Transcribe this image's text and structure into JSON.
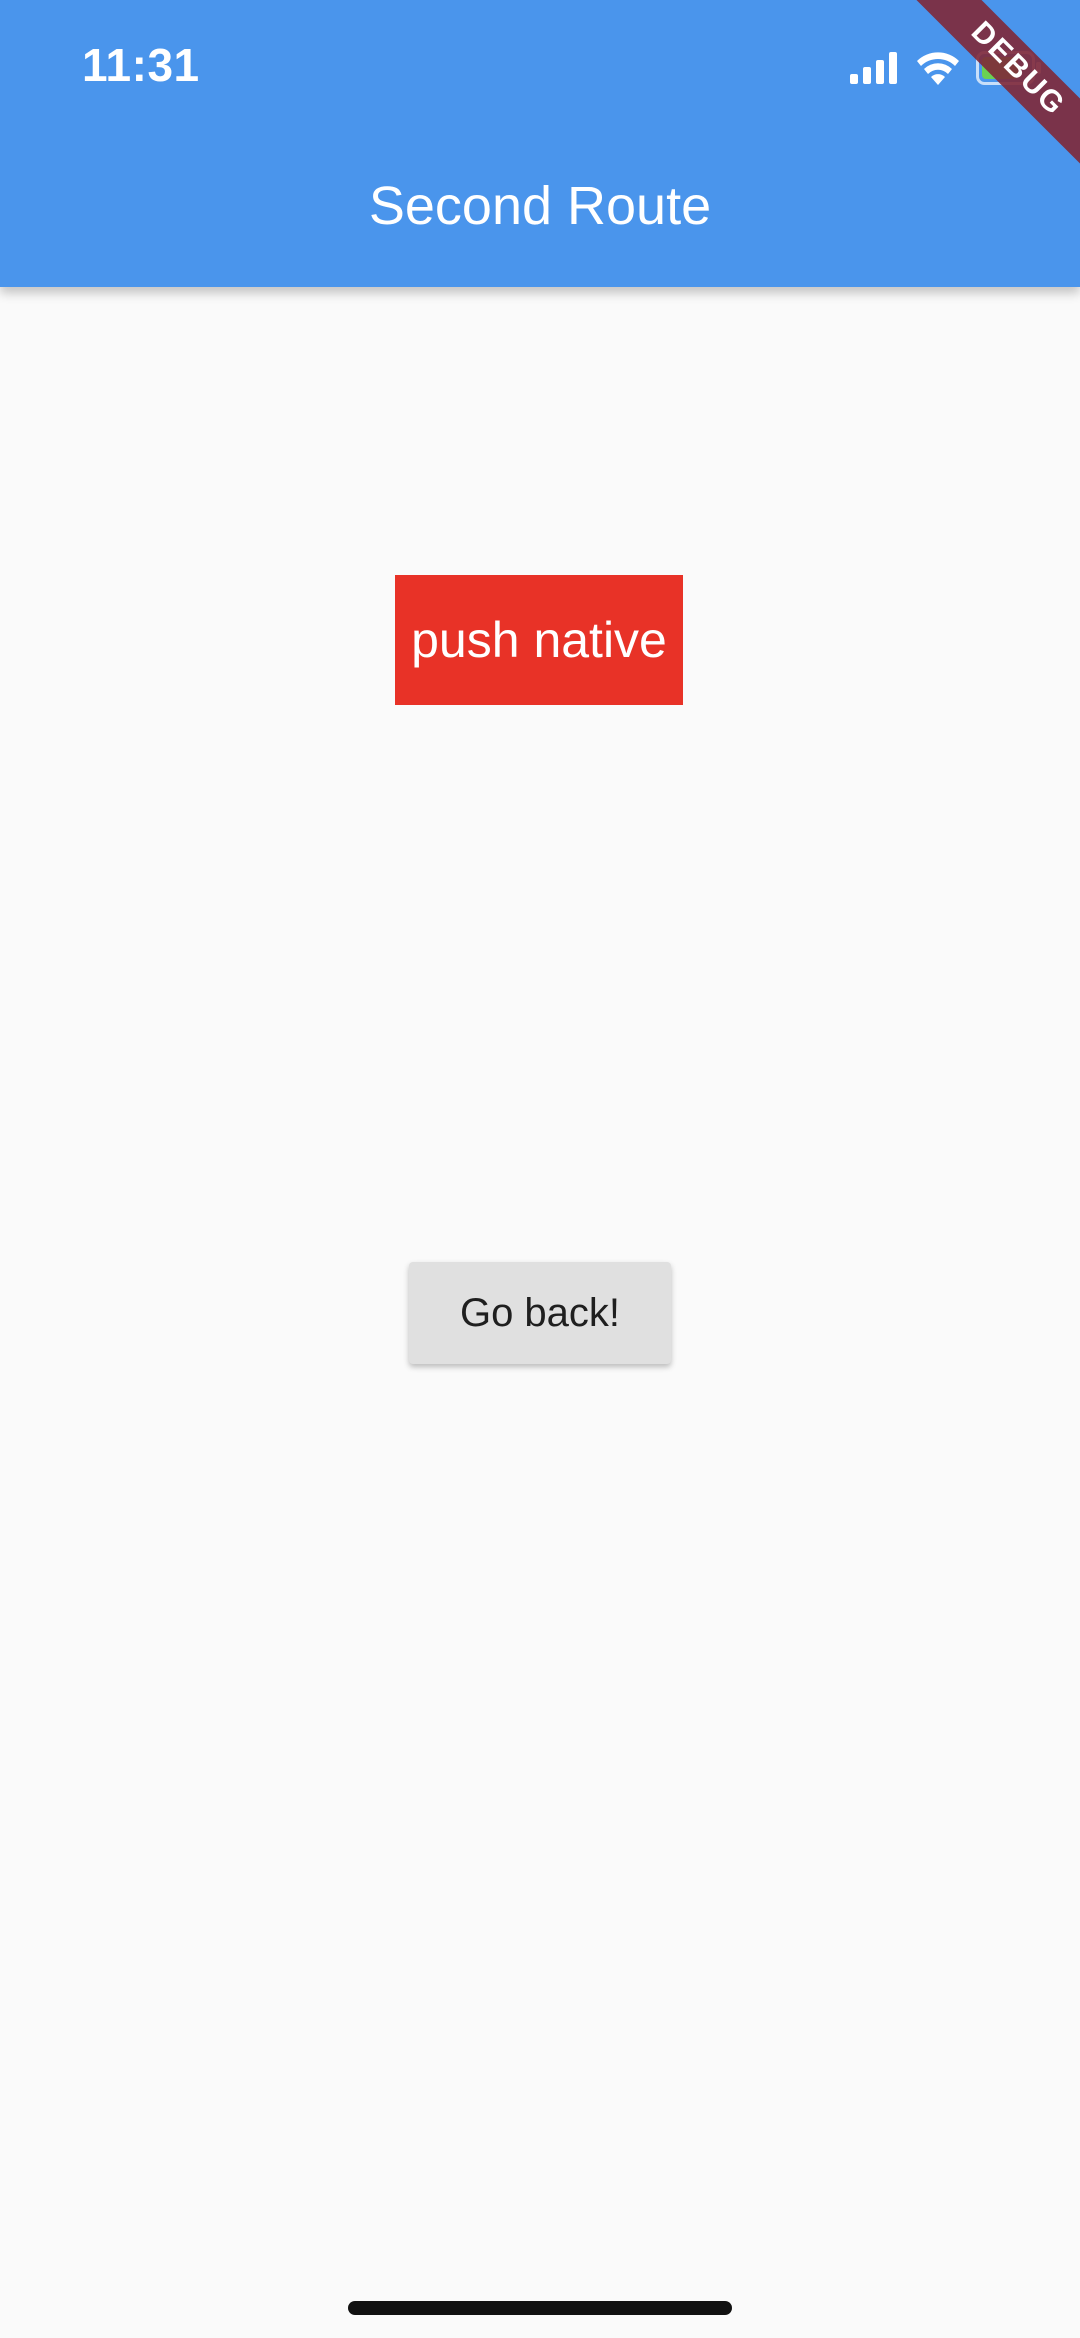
{
  "status_bar": {
    "time": "11:31",
    "icons": [
      "signal-icon",
      "wifi-icon",
      "battery-icon"
    ]
  },
  "app_bar": {
    "title": "Second Route",
    "color": "#4a95ec"
  },
  "debug_banner": {
    "label": "DEBUG"
  },
  "main": {
    "push_native_label": "push native",
    "push_native_color": "#e83227",
    "go_back_label": "Go back!"
  }
}
